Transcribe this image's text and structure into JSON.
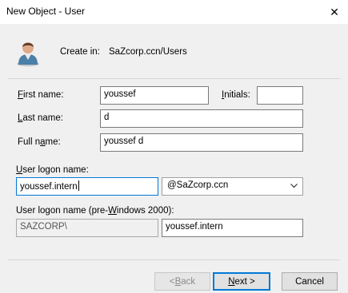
{
  "window": {
    "title": "New Object - User",
    "close_glyph": "✕"
  },
  "header": {
    "icon": "user-icon",
    "create_in_label": "Create in:",
    "create_in_value": "SaZcorp.ccn/Users"
  },
  "form": {
    "first_name": {
      "label_key": "F",
      "label_rest": "irst name:",
      "value": "youssef"
    },
    "initials": {
      "label_key": "I",
      "label_rest": "nitials:",
      "value": ""
    },
    "last_name": {
      "label_key": "L",
      "label_rest": "ast name:",
      "value": "d"
    },
    "full_name": {
      "label_pre": "Full n",
      "label_key": "a",
      "label_rest": "me:",
      "value": "youssef d"
    },
    "logon_name": {
      "label_key": "U",
      "label_rest": "ser logon name:",
      "value": "youssef.intern",
      "domain_selected": "@SaZcorp.ccn"
    },
    "pre2000": {
      "label_pre": "User logon name (pre-",
      "label_key": "W",
      "label_rest": "indows 2000):",
      "domain_value": "SAZCORP\\",
      "value": "youssef.intern"
    }
  },
  "buttons": {
    "back": {
      "pre": "< ",
      "key": "B",
      "rest": "ack"
    },
    "next": {
      "key": "N",
      "rest": "ext >"
    },
    "cancel": {
      "label": "Cancel"
    }
  },
  "colors": {
    "focus": "#0078d7",
    "window_bg": "#f0f0f0",
    "titlebar_bg": "#ffffff"
  }
}
